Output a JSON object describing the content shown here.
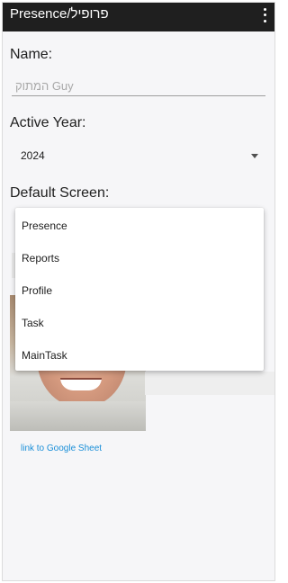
{
  "app_bar": {
    "title": "Presence/פרופיל",
    "menu_icon": "more-vert-icon"
  },
  "name_field": {
    "label": "Name:",
    "value": "",
    "placeholder": "Guy המתוק"
  },
  "active_year": {
    "label": "Active Year:",
    "value": "2024",
    "icon": "caret-down-icon"
  },
  "default_screen": {
    "label": "Default Screen:",
    "options": [
      "Presence",
      "Reports",
      "Profile",
      "Task",
      "MainTask"
    ]
  },
  "profile_photo": {
    "icon": "profile-photo"
  },
  "link": {
    "text": "link to Google Sheet"
  },
  "colors": {
    "app_bar": "#1f1f1f",
    "background": "#f6f6f8",
    "link": "#1a8fd8",
    "menu": "#ffffff"
  }
}
